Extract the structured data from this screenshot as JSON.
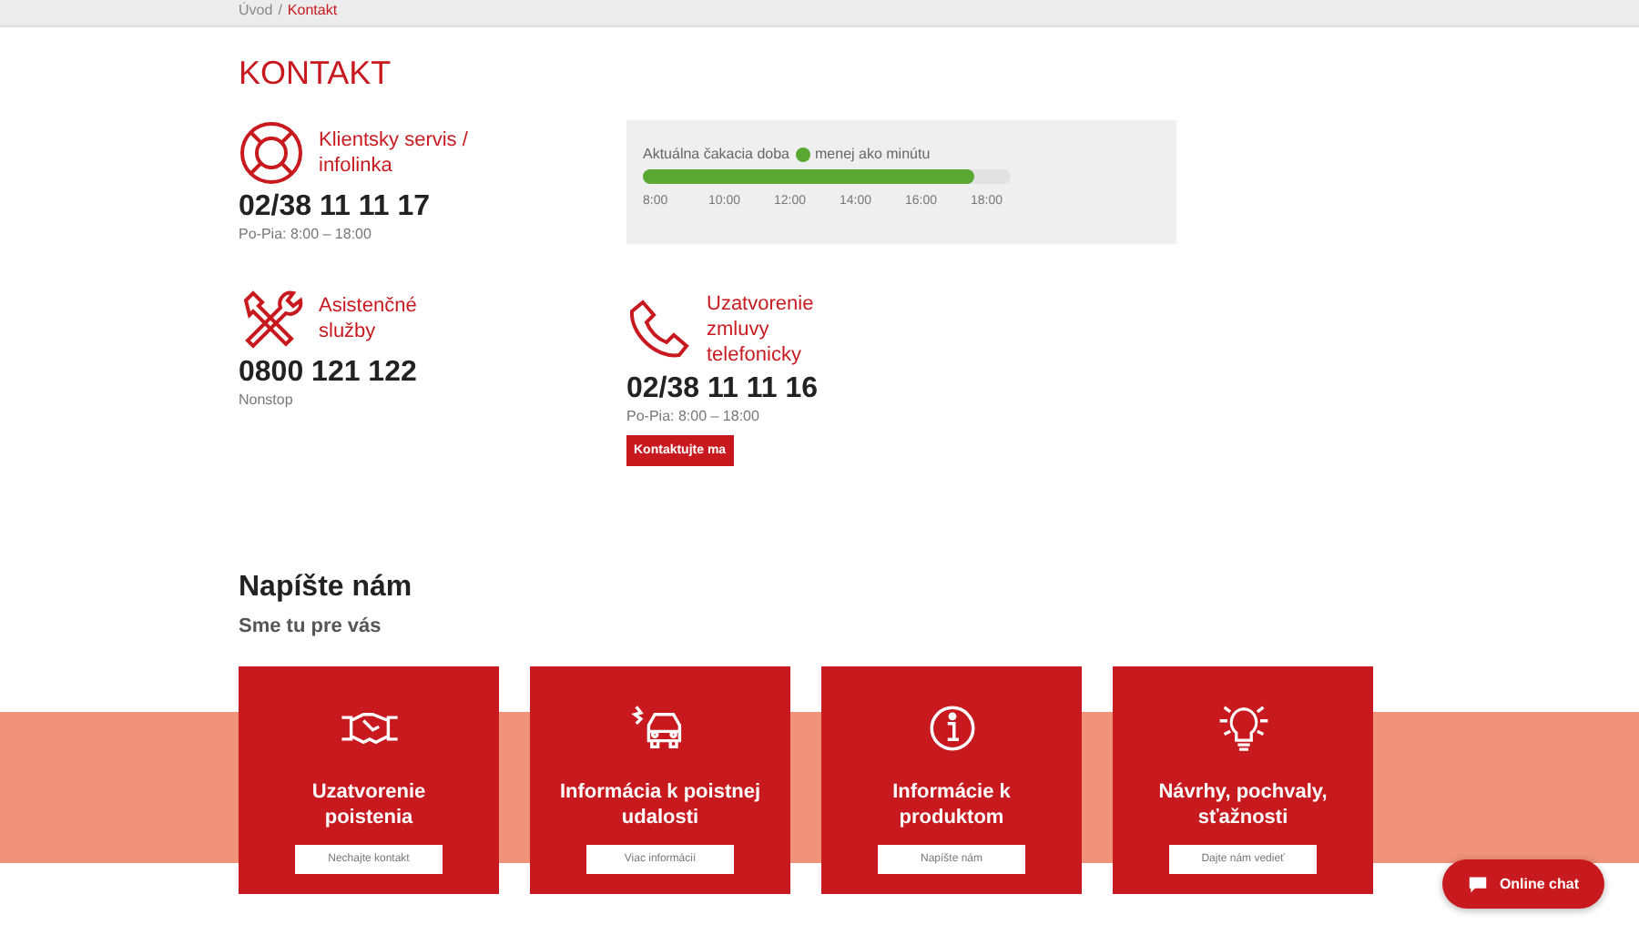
{
  "breadcrumb": [
    {
      "label": "Úvod",
      "selected": false
    },
    {
      "label": "Kontakt",
      "selected": true
    }
  ],
  "breadcrumb_separator": "/",
  "title": "KONTAKT",
  "contacts": [
    {
      "kind": "lifebuoy",
      "label": "Klientsky servis / infolinka",
      "phone": "02/38 11 11 17",
      "hours": "Po-Pia: 8:00 – 18:00"
    },
    {
      "kind": "tools",
      "label": "Asistenčné služby",
      "phone": "0800 121 122",
      "hours": "Nonstop"
    }
  ],
  "wait": {
    "label_before": "Aktuálna čakacia doba",
    "label_after": "menej ako minútu",
    "short_wait": true,
    "level": 0.9,
    "ticks": [
      "8:00",
      "10:00",
      "12:00",
      "14:00",
      "16:00",
      "18:00"
    ]
  },
  "phone_contract": {
    "label": "Uzatvorenie zmluvy telefonicky",
    "phone": "02/38 11 11 16",
    "hours": "Po-Pia: 8:00 – 18:00",
    "button": "Kontaktujte ma"
  },
  "write": {
    "title": "Napíšte nám",
    "subtitle": "Sme tu pre vás"
  },
  "cards": [
    {
      "kind": "handshake",
      "title": "Uzatvorenie poistenia",
      "button": "Nechajte kontakt"
    },
    {
      "kind": "car",
      "title": "Informácia k poistnej udalosti",
      "button": "Viac informácií"
    },
    {
      "kind": "info",
      "title": "Informácie k produktom",
      "button": "Napíšte nám"
    },
    {
      "kind": "bulb",
      "title": "Návrhy, pochvaly, sťažnosti",
      "button": "Dajte nám vedieť"
    }
  ],
  "chat": {
    "label": "Online chat"
  }
}
